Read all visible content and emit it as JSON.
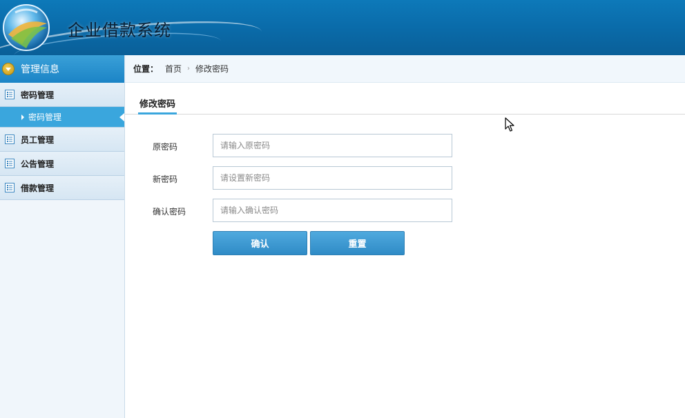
{
  "header": {
    "title": "企业借款系统"
  },
  "sidebar": {
    "section_title": "管理信息",
    "groups": [
      {
        "label": "密码管理",
        "items": [
          {
            "label": "密码管理",
            "active": true
          }
        ]
      },
      {
        "label": "员工管理"
      },
      {
        "label": "公告管理"
      },
      {
        "label": "借款管理"
      }
    ]
  },
  "breadcrumb": {
    "prefix": "位置：",
    "home": "首页",
    "current": "修改密码"
  },
  "tab": {
    "label": "修改密码"
  },
  "form": {
    "old_password": {
      "label": "原密码",
      "placeholder": "请输入原密码",
      "value": ""
    },
    "new_password": {
      "label": "新密码",
      "placeholder": "请设置新密码",
      "value": ""
    },
    "confirm_password": {
      "label": "确认密码",
      "placeholder": "请输入确认密码",
      "value": ""
    },
    "confirm_button": "确认",
    "reset_button": "重置"
  },
  "colors": {
    "header_bg": "#0a6aa8",
    "accent": "#3aa6dd",
    "button": "#2f8bc6"
  },
  "icons": [
    "logo-globe-icon",
    "chevron-down-icon",
    "list-icon",
    "caret-right-icon",
    "mouse-cursor-icon"
  ]
}
